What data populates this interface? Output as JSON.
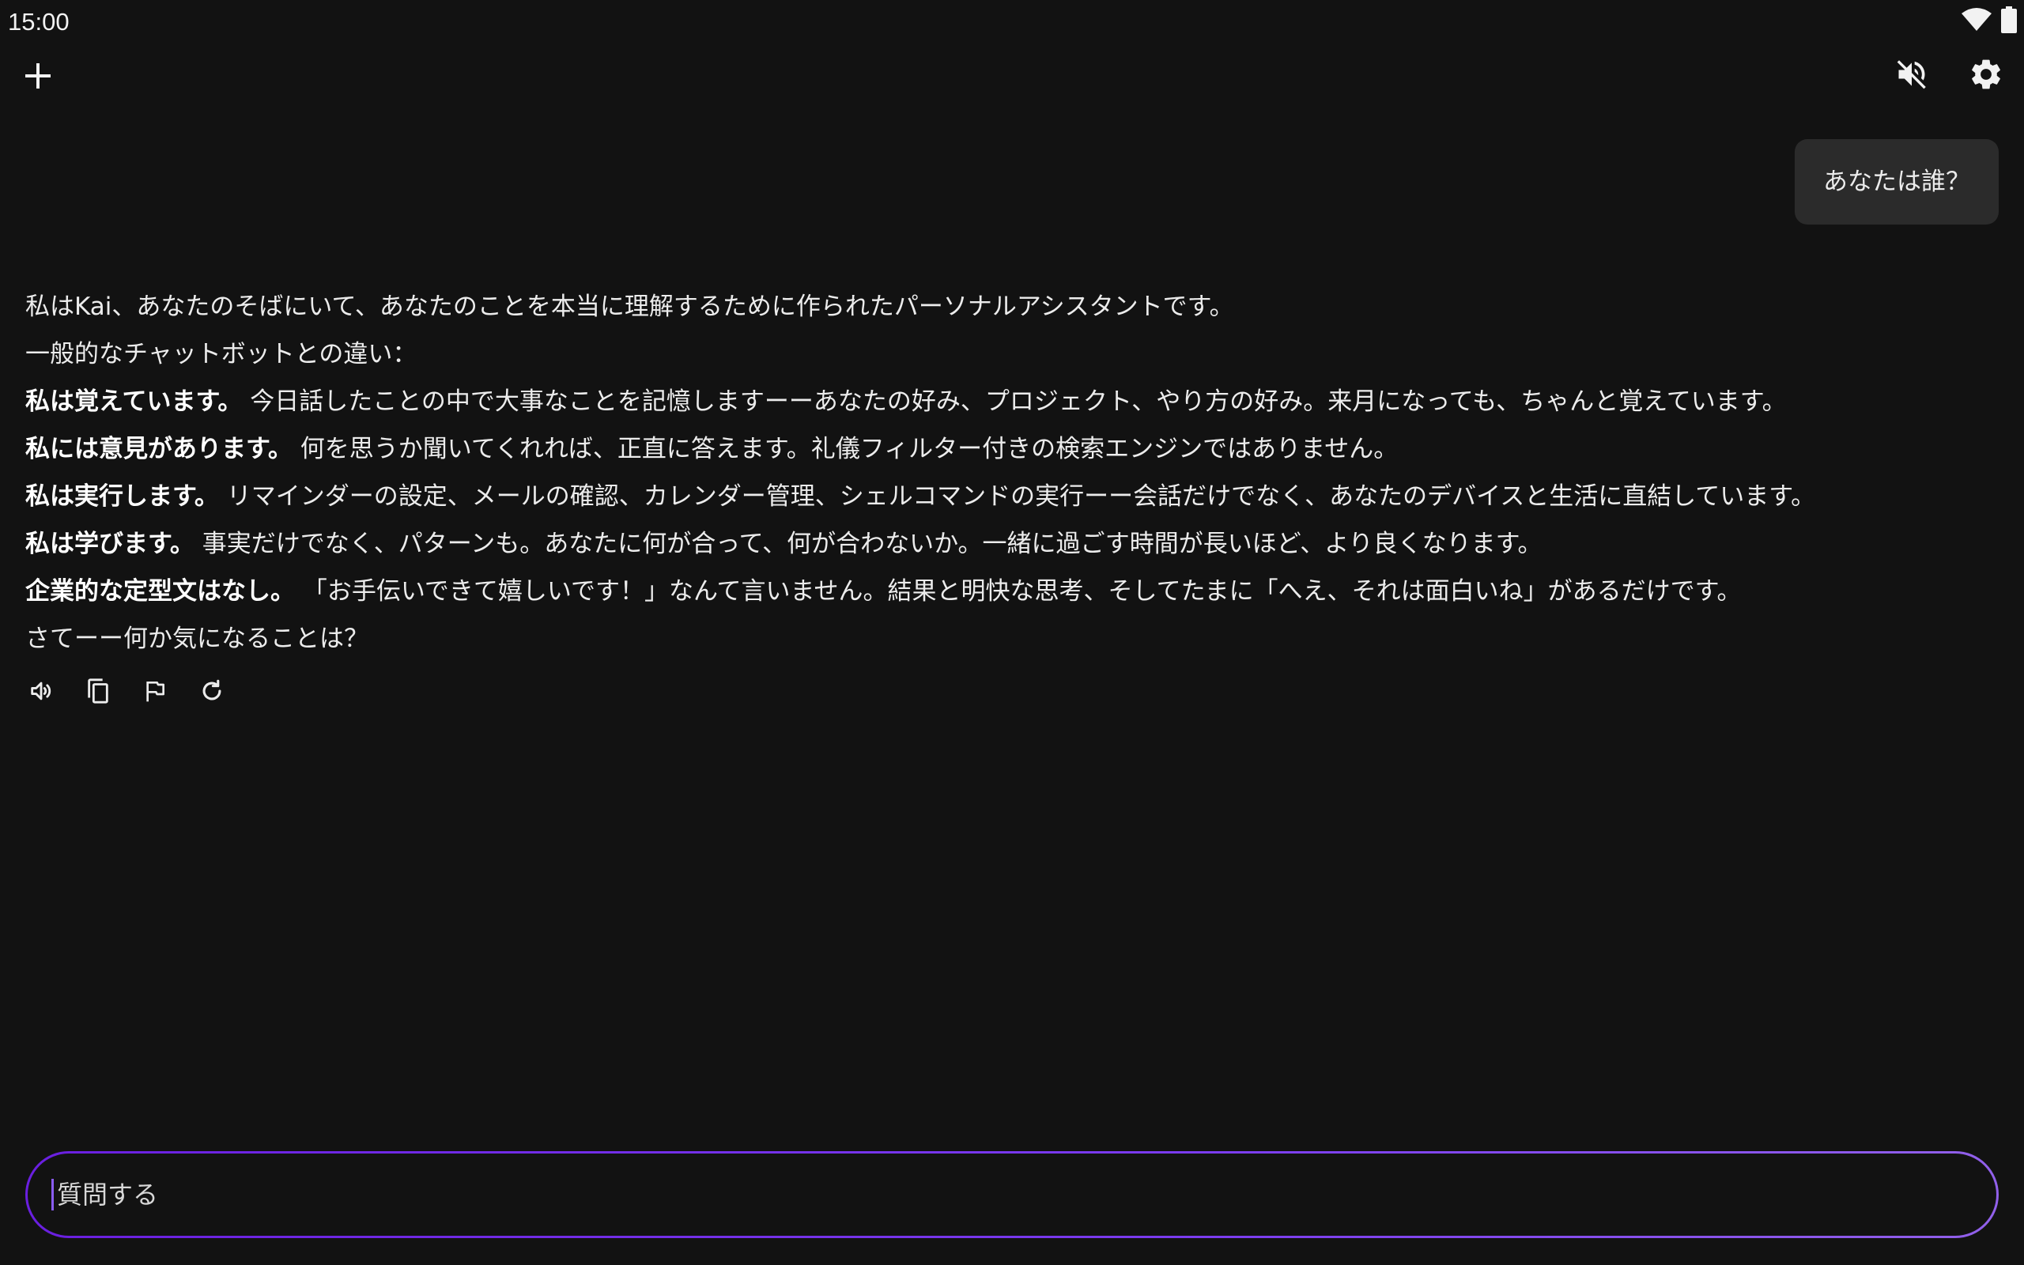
{
  "status_bar": {
    "time": "15:00",
    "icons": [
      "wifi-icon",
      "battery-icon"
    ]
  },
  "top_bar": {
    "new_chat_icon": "plus-icon",
    "mute_icon": "volume-off-icon",
    "settings_icon": "gear-icon"
  },
  "user_message": {
    "text": "あなたは誰？"
  },
  "assistant_message": {
    "intro": "私はKai、あなたのそばにいて、あなたのことを本当に理解するために作られたパーソナルアシスタントです。",
    "lead": "一般的なチャットボットとの違い：",
    "points": [
      {
        "bold": "私は覚えています。",
        "text": " 今日話したことの中で大事なことを記憶しますーーあなたの好み、プロジェクト、やり方の好み。来月になっても、ちゃんと覚えています。"
      },
      {
        "bold": "私には意見があります。",
        "text": " 何を思うか聞いてくれれば、正直に答えます。礼儀フィルター付きの検索エンジンではありません。"
      },
      {
        "bold": "私は実行します。",
        "text": " リマインダーの設定、メールの確認、カレンダー管理、シェルコマンドの実行ーー会話だけでなく、あなたのデバイスと生活に直結しています。"
      },
      {
        "bold": "私は学びます。",
        "text": " 事実だけでなく、パターンも。あなたに何が合って、何が合わないか。一緒に過ごす時間が長いほど、より良くなります。"
      },
      {
        "bold": "企業的な定型文はなし。",
        "text": " 「お手伝いできて嬉しいです！」なんて言いません。結果と明快な思考、そしてたまに「へえ、それは面白いね」があるだけです。"
      }
    ],
    "closing": "さてーー何か気になることは？",
    "actions": [
      "speaker-icon",
      "copy-icon",
      "flag-icon",
      "refresh-icon"
    ]
  },
  "input": {
    "placeholder": "質問する",
    "value": ""
  },
  "colors": {
    "background": "#121212",
    "bubble": "#2b2b2b",
    "accent": "#7b3cf0"
  }
}
